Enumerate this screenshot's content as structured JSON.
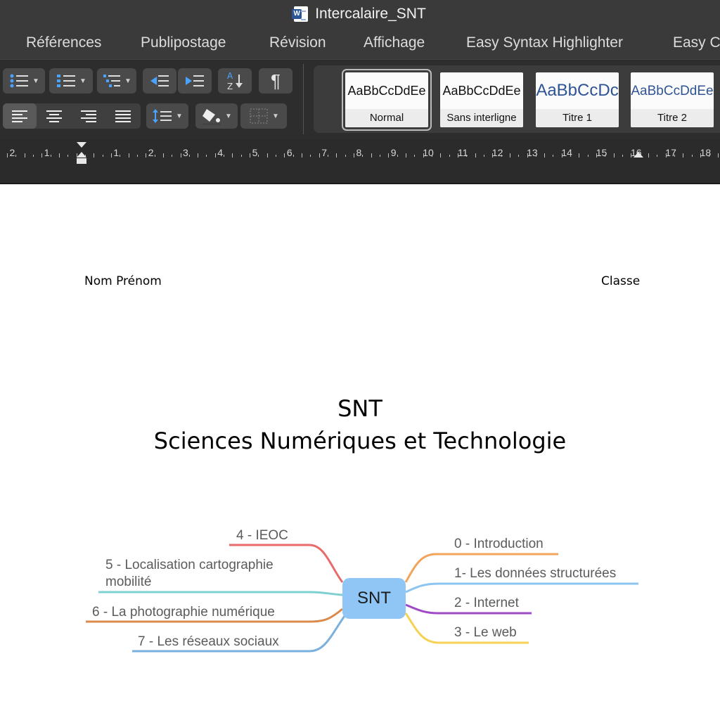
{
  "window": {
    "title": "Intercalaire_SNT"
  },
  "tabs": [
    "Références",
    "Publipostage",
    "Révision",
    "Affichage",
    "Easy Syntax Highlighter",
    "Easy C"
  ],
  "ribbon": {
    "sort_glyph": "A\nZ",
    "pilcrow": "¶",
    "styles": [
      {
        "sample": "AaBbCcDdEe",
        "label": "Normal",
        "color": "#111111"
      },
      {
        "sample": "AaBbCcDdEe",
        "label": "Sans interligne",
        "color": "#111111"
      },
      {
        "sample": "AaBbCcDc",
        "label": "Titre 1",
        "color": "#2f5496"
      },
      {
        "sample": "AaBbCcDdEe",
        "label": "Titre 2",
        "color": "#2f5496"
      }
    ]
  },
  "ruler": {
    "numbers": [
      "2",
      "1",
      "1",
      "2",
      "3",
      "4",
      "5",
      "6",
      "7",
      "8",
      "9",
      "10",
      "11",
      "12",
      "13",
      "14",
      "15",
      "16",
      "17",
      "18"
    ]
  },
  "document": {
    "name_label": "Nom Prénom",
    "class_label": "Classe",
    "title": "SNT",
    "subtitle": "Sciences Numériques et Technologie"
  },
  "mindmap": {
    "center": "SNT",
    "branches": [
      {
        "label": "0 - Introduction",
        "color": "#f2a45a",
        "side": "right"
      },
      {
        "label": "1- Les données structurées",
        "color": "#8cc5f0",
        "side": "right"
      },
      {
        "label": "2 - Internet",
        "color": "#a04ac6",
        "side": "right"
      },
      {
        "label": "3 - Le web",
        "color": "#f5d154",
        "side": "right"
      },
      {
        "label": "4 - IEOC",
        "color": "#e96a6a",
        "side": "left"
      },
      {
        "label": "5 - Localisation cartographie\nmobilité",
        "color": "#7fd0d0",
        "side": "left"
      },
      {
        "label": "6 - La photographie numérique",
        "color": "#d98a4c",
        "side": "left"
      },
      {
        "label": "7 - Les réseaux sociaux",
        "color": "#7ab0de",
        "side": "left"
      }
    ]
  }
}
